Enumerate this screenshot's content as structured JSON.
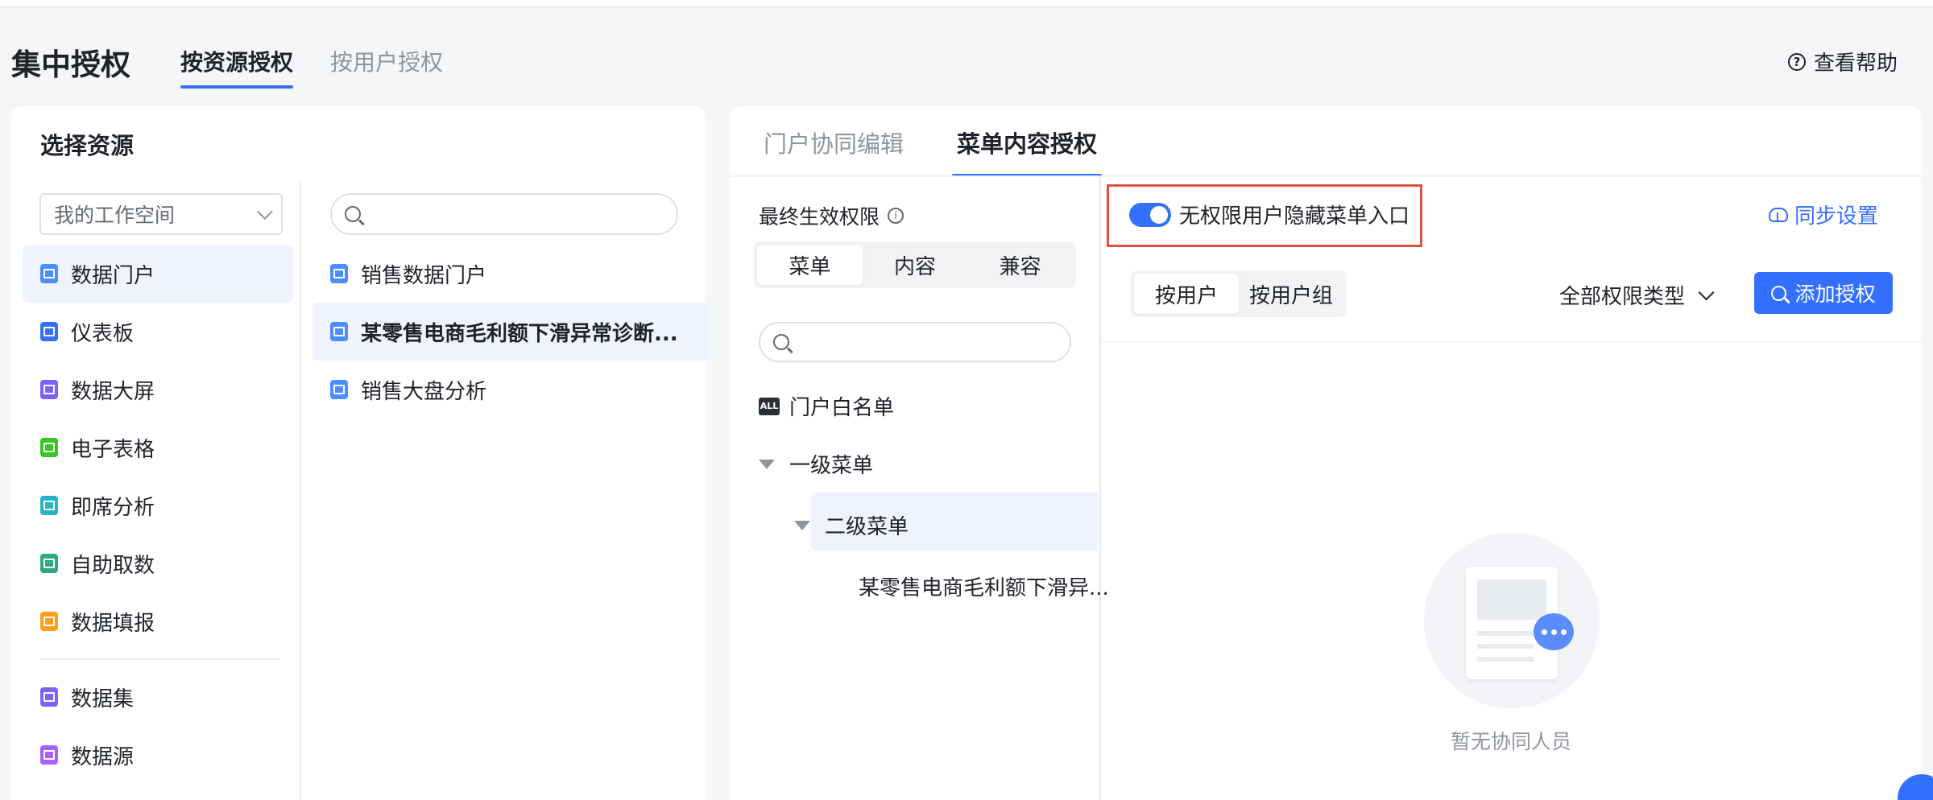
{
  "header": {
    "title": "集中授权",
    "tabs": [
      {
        "label": "按资源授权",
        "active": true
      },
      {
        "label": "按用户授权",
        "active": false
      }
    ],
    "help_label": "查看帮助"
  },
  "left_panel": {
    "title": "选择资源",
    "workspace_select": "我的工作空间",
    "resource_search_placeholder": "",
    "resource_types": [
      {
        "label": "数据门户",
        "icon": "portal-icon",
        "color": "#4c8dff",
        "active": true
      },
      {
        "label": "仪表板",
        "icon": "dashboard-icon",
        "color": "#3370ff"
      },
      {
        "label": "数据大屏",
        "icon": "screen-icon",
        "color": "#7b61ff"
      },
      {
        "label": "电子表格",
        "icon": "spreadsheet-icon",
        "color": "#34c724"
      },
      {
        "label": "即席分析",
        "icon": "adhoc-analysis-icon",
        "color": "#26b5c6"
      },
      {
        "label": "自助取数",
        "icon": "self-service-icon",
        "color": "#2ea884"
      },
      {
        "label": "数据填报",
        "icon": "data-entry-icon",
        "color": "#ff9f1a"
      },
      {
        "label": "数据集",
        "icon": "dataset-icon",
        "color": "#7b61ff"
      },
      {
        "label": "数据源",
        "icon": "datasource-icon",
        "color": "#a861ff"
      }
    ],
    "resources": [
      {
        "label": "销售数据门户",
        "active": false
      },
      {
        "label": "某零售电商毛利额下滑异常诊断...",
        "active": true
      },
      {
        "label": "销售大盘分析",
        "active": false
      }
    ]
  },
  "right_panel": {
    "tabs": [
      {
        "label": "门户协同编辑",
        "active": false
      },
      {
        "label": "菜单内容授权",
        "active": true
      }
    ],
    "effective_permission_label": "最终生效权限",
    "permission_segments": [
      "菜单",
      "内容",
      "兼容"
    ],
    "menu_search_placeholder": "",
    "tree": {
      "whitelist": "门户白名单",
      "level1": "一级菜单",
      "level2": "二级菜单",
      "leaf": "某零售电商毛利额下滑异..."
    },
    "hide_menu_toggle": {
      "label": "无权限用户隐藏菜单入口",
      "on": true
    },
    "sync_settings": "同步设置",
    "user_segments": [
      "按用户",
      "按用户组"
    ],
    "permission_type_filter": "全部权限类型",
    "add_button": "添加授权",
    "empty_text": "暂无协同人员",
    "accent_color": "#3370ff"
  }
}
